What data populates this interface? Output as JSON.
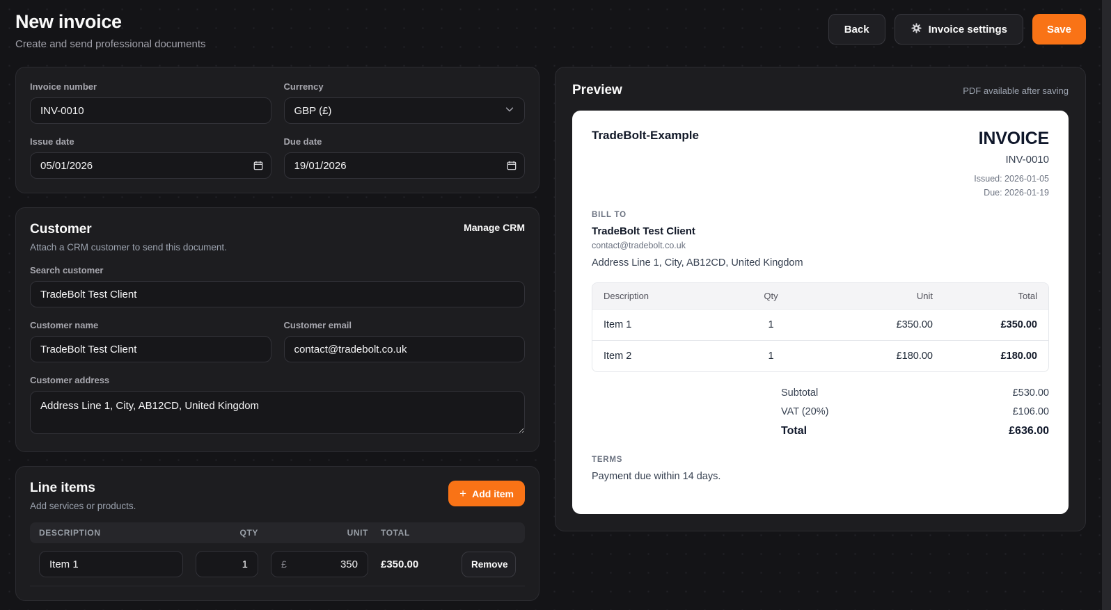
{
  "header": {
    "title": "New invoice",
    "subtitle": "Create and send professional documents",
    "back_label": "Back",
    "settings_label": "Invoice settings",
    "save_label": "Save"
  },
  "details": {
    "invoice_number": {
      "label": "Invoice number",
      "value": "INV-0010"
    },
    "currency": {
      "label": "Currency",
      "value": "GBP (£)"
    },
    "issue_date": {
      "label": "Issue date",
      "value": "05/01/2026"
    },
    "due_date": {
      "label": "Due date",
      "value": "19/01/2026"
    }
  },
  "customer": {
    "title": "Customer",
    "manage_crm_label": "Manage CRM",
    "subtitle": "Attach a CRM customer to send this document.",
    "search": {
      "label": "Search customer",
      "value": "TradeBolt Test Client"
    },
    "name": {
      "label": "Customer name",
      "value": "TradeBolt Test Client"
    },
    "email": {
      "label": "Customer email",
      "value": "contact@tradebolt.co.uk"
    },
    "address": {
      "label": "Customer address",
      "value": "Address Line 1, City, AB12CD, United Kingdom"
    }
  },
  "line_items": {
    "title": "Line items",
    "subtitle": "Add services or products.",
    "add_item_label": "Add item",
    "columns": {
      "description": "DESCRIPTION",
      "qty": "QTY",
      "unit": "UNIT",
      "total": "TOTAL"
    },
    "rows": [
      {
        "description": "Item 1",
        "qty": "1",
        "currency_symbol": "£",
        "unit": "350",
        "total": "£350.00",
        "remove_label": "Remove"
      }
    ]
  },
  "preview": {
    "title": "Preview",
    "pdf_note": "PDF available after saving",
    "invoice": {
      "business_name": "TradeBolt-Example",
      "doc_type": "INVOICE",
      "number": "INV-0010",
      "issued": "Issued: 2026-01-05",
      "due": "Due: 2026-01-19",
      "bill_to_label": "BILL TO",
      "client_name": "TradeBolt Test Client",
      "client_email": "contact@tradebolt.co.uk",
      "client_address": "Address Line 1, City, AB12CD, United Kingdom",
      "columns": {
        "description": "Description",
        "qty": "Qty",
        "unit": "Unit",
        "total": "Total"
      },
      "rows": [
        {
          "description": "Item 1",
          "qty": "1",
          "unit": "£350.00",
          "total": "£350.00"
        },
        {
          "description": "Item 2",
          "qty": "1",
          "unit": "£180.00",
          "total": "£180.00"
        }
      ],
      "totals": {
        "subtotal_label": "Subtotal",
        "subtotal": "£530.00",
        "vat_label": "VAT (20%)",
        "vat": "£106.00",
        "total_label": "Total",
        "total": "£636.00"
      },
      "terms_label": "TERMS",
      "terms": "Payment due within 14 days."
    }
  },
  "colors": {
    "accent": "#f97316",
    "page_bg": "#141417",
    "card_bg": "#1d1d20",
    "invoice_bg": "#ffffff"
  }
}
